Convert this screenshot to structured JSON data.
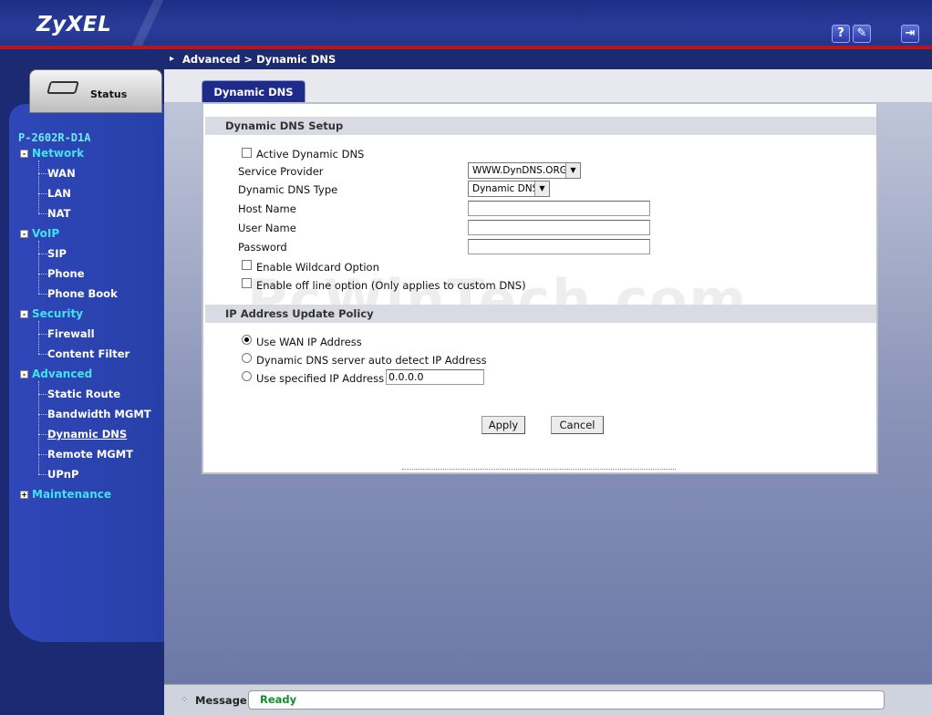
{
  "header": {
    "logo": "ZyXEL",
    "help_icon": "?",
    "wizard_icon": "✎",
    "logout_icon": "⇥"
  },
  "sidebar": {
    "status_label": "Status",
    "model": "P-2602R-D1A",
    "groups": [
      {
        "label": "Network",
        "toggle": "-",
        "items": [
          "WAN",
          "LAN",
          "NAT"
        ]
      },
      {
        "label": "VoIP",
        "toggle": "-",
        "items": [
          "SIP",
          "Phone",
          "Phone Book"
        ]
      },
      {
        "label": "Security",
        "toggle": "-",
        "items": [
          "Firewall",
          "Content Filter"
        ]
      },
      {
        "label": "Advanced",
        "toggle": "-",
        "items": [
          "Static Route",
          "Bandwidth MGMT",
          "Dynamic DNS",
          "Remote MGMT",
          "UPnP"
        ]
      },
      {
        "label": "Maintenance",
        "toggle": "+",
        "items": []
      }
    ],
    "active_item": "Dynamic DNS"
  },
  "breadcrumb": "Advanced > Dynamic DNS",
  "tab": "Dynamic DNS",
  "setup": {
    "title": "Dynamic DNS Setup",
    "active_ddns": "Active Dynamic DNS",
    "service_provider_label": "Service Provider",
    "service_provider_value": "WWW.DynDNS.ORG",
    "ddns_type_label": "Dynamic DNS Type",
    "ddns_type_value": "Dynamic DNS",
    "host_name_label": "Host Name",
    "host_name_value": "",
    "user_name_label": "User Name",
    "user_name_value": "",
    "password_label": "Password",
    "password_value": "",
    "wildcard": "Enable Wildcard Option",
    "offline": "Enable off line option (Only applies to custom DNS)"
  },
  "policy": {
    "title": "IP Address Update Policy",
    "wan_ip": "Use WAN IP Address",
    "auto_detect": "Dynamic DNS server auto detect IP Address",
    "specified": "Use specified IP Address",
    "specified_value": "0.0.0.0"
  },
  "buttons": {
    "apply": "Apply",
    "cancel": "Cancel"
  },
  "watermark": "PcWinTech.com",
  "statusbar": {
    "label": "Message",
    "value": "Ready"
  }
}
